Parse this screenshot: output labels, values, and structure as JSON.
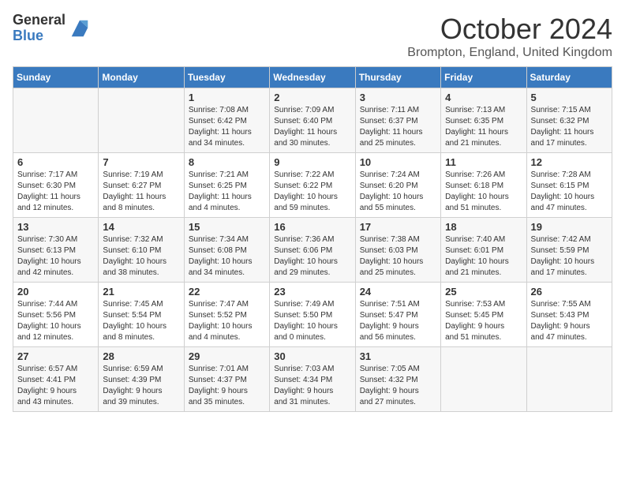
{
  "header": {
    "logo_line1": "General",
    "logo_line2": "Blue",
    "month": "October 2024",
    "location": "Brompton, England, United Kingdom"
  },
  "days_of_week": [
    "Sunday",
    "Monday",
    "Tuesday",
    "Wednesday",
    "Thursday",
    "Friday",
    "Saturday"
  ],
  "weeks": [
    [
      {
        "day": "",
        "content": ""
      },
      {
        "day": "",
        "content": ""
      },
      {
        "day": "1",
        "content": "Sunrise: 7:08 AM\nSunset: 6:42 PM\nDaylight: 11 hours\nand 34 minutes."
      },
      {
        "day": "2",
        "content": "Sunrise: 7:09 AM\nSunset: 6:40 PM\nDaylight: 11 hours\nand 30 minutes."
      },
      {
        "day": "3",
        "content": "Sunrise: 7:11 AM\nSunset: 6:37 PM\nDaylight: 11 hours\nand 25 minutes."
      },
      {
        "day": "4",
        "content": "Sunrise: 7:13 AM\nSunset: 6:35 PM\nDaylight: 11 hours\nand 21 minutes."
      },
      {
        "day": "5",
        "content": "Sunrise: 7:15 AM\nSunset: 6:32 PM\nDaylight: 11 hours\nand 17 minutes."
      }
    ],
    [
      {
        "day": "6",
        "content": "Sunrise: 7:17 AM\nSunset: 6:30 PM\nDaylight: 11 hours\nand 12 minutes."
      },
      {
        "day": "7",
        "content": "Sunrise: 7:19 AM\nSunset: 6:27 PM\nDaylight: 11 hours\nand 8 minutes."
      },
      {
        "day": "8",
        "content": "Sunrise: 7:21 AM\nSunset: 6:25 PM\nDaylight: 11 hours\nand 4 minutes."
      },
      {
        "day": "9",
        "content": "Sunrise: 7:22 AM\nSunset: 6:22 PM\nDaylight: 10 hours\nand 59 minutes."
      },
      {
        "day": "10",
        "content": "Sunrise: 7:24 AM\nSunset: 6:20 PM\nDaylight: 10 hours\nand 55 minutes."
      },
      {
        "day": "11",
        "content": "Sunrise: 7:26 AM\nSunset: 6:18 PM\nDaylight: 10 hours\nand 51 minutes."
      },
      {
        "day": "12",
        "content": "Sunrise: 7:28 AM\nSunset: 6:15 PM\nDaylight: 10 hours\nand 47 minutes."
      }
    ],
    [
      {
        "day": "13",
        "content": "Sunrise: 7:30 AM\nSunset: 6:13 PM\nDaylight: 10 hours\nand 42 minutes."
      },
      {
        "day": "14",
        "content": "Sunrise: 7:32 AM\nSunset: 6:10 PM\nDaylight: 10 hours\nand 38 minutes."
      },
      {
        "day": "15",
        "content": "Sunrise: 7:34 AM\nSunset: 6:08 PM\nDaylight: 10 hours\nand 34 minutes."
      },
      {
        "day": "16",
        "content": "Sunrise: 7:36 AM\nSunset: 6:06 PM\nDaylight: 10 hours\nand 29 minutes."
      },
      {
        "day": "17",
        "content": "Sunrise: 7:38 AM\nSunset: 6:03 PM\nDaylight: 10 hours\nand 25 minutes."
      },
      {
        "day": "18",
        "content": "Sunrise: 7:40 AM\nSunset: 6:01 PM\nDaylight: 10 hours\nand 21 minutes."
      },
      {
        "day": "19",
        "content": "Sunrise: 7:42 AM\nSunset: 5:59 PM\nDaylight: 10 hours\nand 17 minutes."
      }
    ],
    [
      {
        "day": "20",
        "content": "Sunrise: 7:44 AM\nSunset: 5:56 PM\nDaylight: 10 hours\nand 12 minutes."
      },
      {
        "day": "21",
        "content": "Sunrise: 7:45 AM\nSunset: 5:54 PM\nDaylight: 10 hours\nand 8 minutes."
      },
      {
        "day": "22",
        "content": "Sunrise: 7:47 AM\nSunset: 5:52 PM\nDaylight: 10 hours\nand 4 minutes."
      },
      {
        "day": "23",
        "content": "Sunrise: 7:49 AM\nSunset: 5:50 PM\nDaylight: 10 hours\nand 0 minutes."
      },
      {
        "day": "24",
        "content": "Sunrise: 7:51 AM\nSunset: 5:47 PM\nDaylight: 9 hours\nand 56 minutes."
      },
      {
        "day": "25",
        "content": "Sunrise: 7:53 AM\nSunset: 5:45 PM\nDaylight: 9 hours\nand 51 minutes."
      },
      {
        "day": "26",
        "content": "Sunrise: 7:55 AM\nSunset: 5:43 PM\nDaylight: 9 hours\nand 47 minutes."
      }
    ],
    [
      {
        "day": "27",
        "content": "Sunrise: 6:57 AM\nSunset: 4:41 PM\nDaylight: 9 hours\nand 43 minutes."
      },
      {
        "day": "28",
        "content": "Sunrise: 6:59 AM\nSunset: 4:39 PM\nDaylight: 9 hours\nand 39 minutes."
      },
      {
        "day": "29",
        "content": "Sunrise: 7:01 AM\nSunset: 4:37 PM\nDaylight: 9 hours\nand 35 minutes."
      },
      {
        "day": "30",
        "content": "Sunrise: 7:03 AM\nSunset: 4:34 PM\nDaylight: 9 hours\nand 31 minutes."
      },
      {
        "day": "31",
        "content": "Sunrise: 7:05 AM\nSunset: 4:32 PM\nDaylight: 9 hours\nand 27 minutes."
      },
      {
        "day": "",
        "content": ""
      },
      {
        "day": "",
        "content": ""
      }
    ]
  ]
}
